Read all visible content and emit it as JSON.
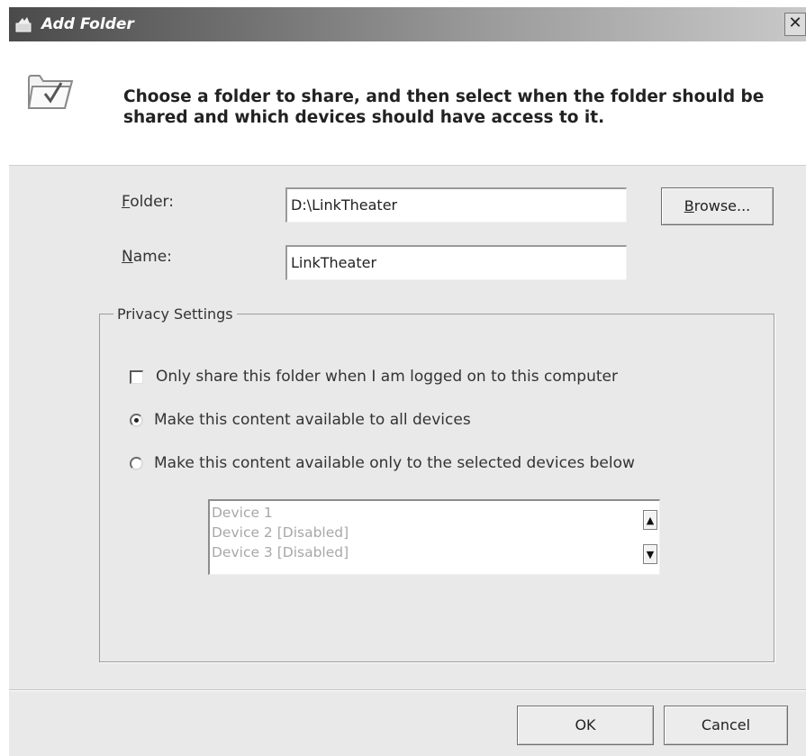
{
  "window": {
    "title": "Add Folder",
    "close_glyph": "✕"
  },
  "header": {
    "instruction": "Choose a folder to share, and then select when the folder should be shared and which devices should have access to it.",
    "icon": "folder-check-icon"
  },
  "form": {
    "folder_label_accel": "F",
    "folder_label_rest": "older:",
    "folder_value": "D:\\LinkTheater",
    "browse_accel": "B",
    "browse_rest": "rowse...",
    "name_label_accel": "N",
    "name_label_rest": "ame:",
    "name_value": "LinkTheater"
  },
  "privacy": {
    "legend": "Privacy Settings",
    "only_logged_on_label": "Only share this folder when I am logged on to this computer",
    "only_logged_on_checked": false,
    "all_devices_label": "Make this content available to all devices",
    "all_devices_selected": true,
    "selected_devices_label": "Make this content available only to the selected devices below",
    "selected_devices_selected": false,
    "devices": [
      "Device 1",
      "Device 2 [Disabled]",
      "Device 3 [Disabled]"
    ]
  },
  "buttons": {
    "ok": "OK",
    "cancel": "Cancel"
  },
  "colors": {
    "dialog_bg": "#e9e9e9",
    "disabled_text": "#a8a8a8"
  }
}
